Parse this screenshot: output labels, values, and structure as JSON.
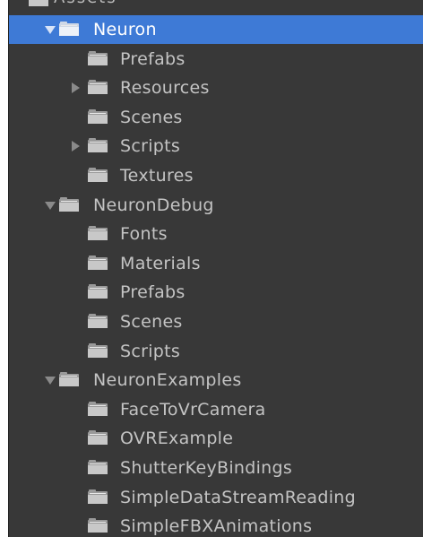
{
  "top_partial": {
    "label": "Assets"
  },
  "tree": [
    {
      "label": "Neuron",
      "depth": 0,
      "arrow": "expanded",
      "selected": true
    },
    {
      "label": "Prefabs",
      "depth": 1,
      "arrow": "none",
      "selected": false
    },
    {
      "label": "Resources",
      "depth": 1,
      "arrow": "collapsed",
      "selected": false
    },
    {
      "label": "Scenes",
      "depth": 1,
      "arrow": "none",
      "selected": false
    },
    {
      "label": "Scripts",
      "depth": 1,
      "arrow": "collapsed",
      "selected": false
    },
    {
      "label": "Textures",
      "depth": 1,
      "arrow": "none",
      "selected": false
    },
    {
      "label": "NeuronDebug",
      "depth": 0,
      "arrow": "expanded",
      "selected": false
    },
    {
      "label": "Fonts",
      "depth": 1,
      "arrow": "none",
      "selected": false
    },
    {
      "label": "Materials",
      "depth": 1,
      "arrow": "none",
      "selected": false
    },
    {
      "label": "Prefabs",
      "depth": 1,
      "arrow": "none",
      "selected": false
    },
    {
      "label": "Scenes",
      "depth": 1,
      "arrow": "none",
      "selected": false
    },
    {
      "label": "Scripts",
      "depth": 1,
      "arrow": "none",
      "selected": false
    },
    {
      "label": "NeuronExamples",
      "depth": 0,
      "arrow": "expanded",
      "selected": false
    },
    {
      "label": "FaceToVrCamera",
      "depth": 1,
      "arrow": "none",
      "selected": false
    },
    {
      "label": "OVRExample",
      "depth": 1,
      "arrow": "none",
      "selected": false
    },
    {
      "label": "ShutterKeyBindings",
      "depth": 1,
      "arrow": "none",
      "selected": false
    },
    {
      "label": "SimpleDataStreamReading",
      "depth": 1,
      "arrow": "none",
      "selected": false
    },
    {
      "label": "SimpleFBXAnimations",
      "depth": 1,
      "arrow": "none",
      "selected": false
    }
  ],
  "icons": {
    "folder": "folder-icon",
    "expanded": "expand-arrow-icon",
    "collapsed": "collapse-arrow-icon"
  },
  "colors": {
    "background": "#383838",
    "selection": "#3e7ad6",
    "text": "#c4c4c4",
    "selected_text": "#ffffff"
  }
}
